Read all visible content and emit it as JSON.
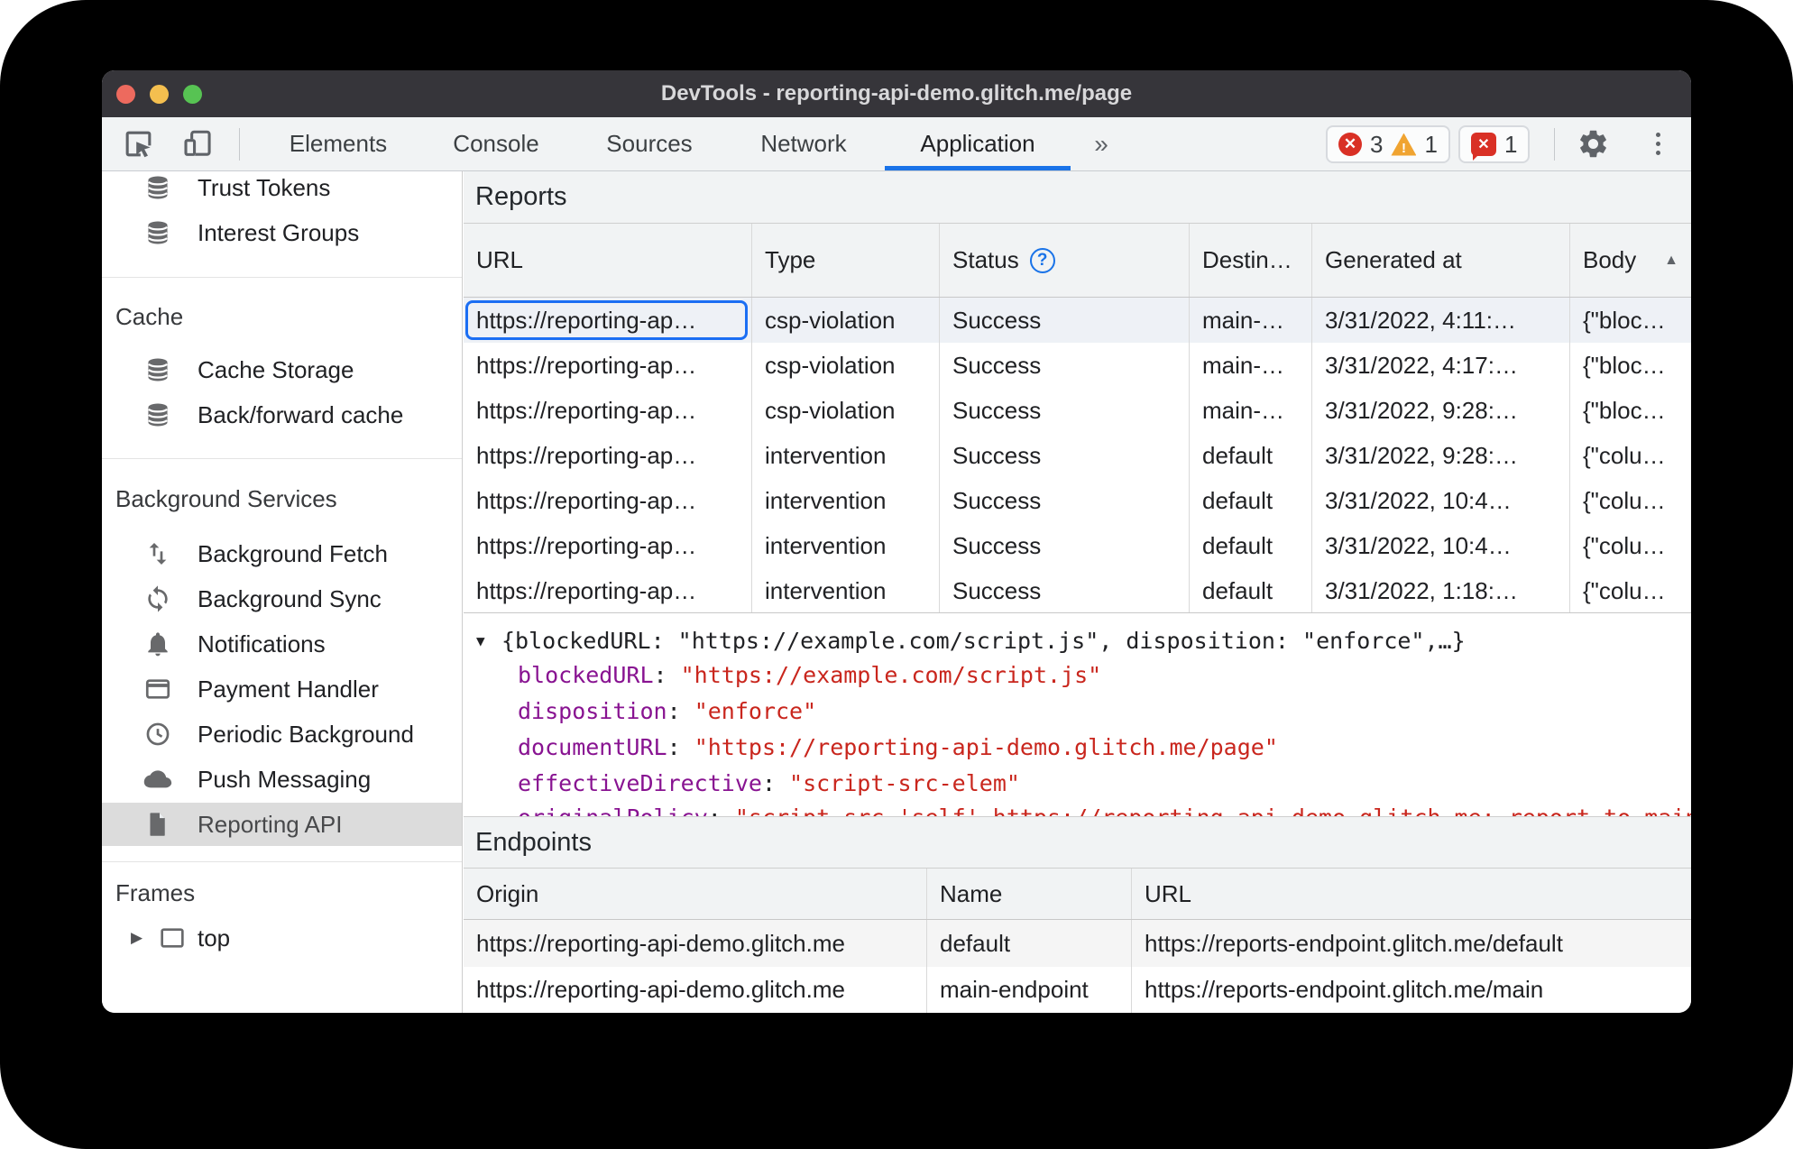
{
  "colors": {
    "accent": "#1a73e8",
    "error": "#d93025",
    "warning": "#f0a431",
    "json_key": "#881391",
    "json_string": "#c9261d",
    "traffic_red": "#ed6a5e",
    "traffic_yellow": "#f4bf4f",
    "traffic_green": "#57c353"
  },
  "window": {
    "title": "DevTools - reporting-api-demo.glitch.me/page",
    "traffic_buttons": [
      "close-button",
      "minimize-button",
      "zoom-button"
    ]
  },
  "toolbar": {
    "inspect_icon": "inspect-cursor-icon",
    "device_icon": "device-toolbar-icon",
    "tabs": [
      {
        "label": "Elements"
      },
      {
        "label": "Console"
      },
      {
        "label": "Sources"
      },
      {
        "label": "Network"
      },
      {
        "label": "Application",
        "selected": true
      }
    ],
    "more_tabs_symbol": "»",
    "badges": {
      "errors": "3",
      "warnings": "1",
      "issues": "1"
    },
    "gear_icon": "settings-gear-icon",
    "menu_icon": "kebab-menu-icon"
  },
  "sidebar": {
    "top_items": [
      {
        "label": "Trust Tokens",
        "icon": "database-icon"
      },
      {
        "label": "Interest Groups",
        "icon": "database-icon"
      }
    ],
    "sections": [
      {
        "title": "Cache",
        "items": [
          {
            "label": "Cache Storage",
            "icon": "database-icon"
          },
          {
            "label": "Back/forward cache",
            "icon": "database-icon"
          }
        ]
      },
      {
        "title": "Background Services",
        "items": [
          {
            "label": "Background Fetch",
            "icon": "background-fetch-icon"
          },
          {
            "label": "Background Sync",
            "icon": "background-sync-icon"
          },
          {
            "label": "Notifications",
            "icon": "bell-icon"
          },
          {
            "label": "Payment Handler",
            "icon": "payment-card-icon"
          },
          {
            "label": "Periodic Background",
            "icon": "clock-icon"
          },
          {
            "label": "Push Messaging",
            "icon": "cloud-icon"
          },
          {
            "label": "Reporting API",
            "icon": "document-icon",
            "selected": true
          }
        ]
      },
      {
        "title": "Frames",
        "items": [
          {
            "label": "top",
            "icon": "frame-icon",
            "expander": "▶"
          }
        ]
      }
    ]
  },
  "reports": {
    "heading": "Reports",
    "columns": [
      "URL",
      "Type",
      "Status",
      "Destin…",
      "Generated at",
      "Body"
    ],
    "status_help_icon": "help-icon",
    "sort_icon": "▲",
    "rows": [
      {
        "url": "https://reporting-ap…",
        "type": "csp-violation",
        "status": "Success",
        "destination": "main-…",
        "generated": "3/31/2022, 4:11:…",
        "body": "{\"bloc…",
        "selected": true
      },
      {
        "url": "https://reporting-ap…",
        "type": "csp-violation",
        "status": "Success",
        "destination": "main-…",
        "generated": "3/31/2022, 4:17:…",
        "body": "{\"bloc…"
      },
      {
        "url": "https://reporting-ap…",
        "type": "csp-violation",
        "status": "Success",
        "destination": "main-…",
        "generated": "3/31/2022, 9:28:…",
        "body": "{\"bloc…"
      },
      {
        "url": "https://reporting-ap…",
        "type": "intervention",
        "status": "Success",
        "destination": "default",
        "generated": "3/31/2022, 9:28:…",
        "body": "{\"colu…"
      },
      {
        "url": "https://reporting-ap…",
        "type": "intervention",
        "status": "Success",
        "destination": "default",
        "generated": "3/31/2022, 10:4…",
        "body": "{\"colu…"
      },
      {
        "url": "https://reporting-ap…",
        "type": "intervention",
        "status": "Success",
        "destination": "default",
        "generated": "3/31/2022, 10:4…",
        "body": "{\"colu…"
      },
      {
        "url": "https://reporting-ap…",
        "type": "intervention",
        "status": "Success",
        "destination": "default",
        "generated": "3/31/2022, 1:18:…",
        "body": "{\"colu…"
      }
    ]
  },
  "detail": {
    "expander": "▼",
    "summary": "{blockedURL: \"https://example.com/script.js\", disposition: \"enforce\",…}",
    "fields": [
      {
        "key": "blockedURL",
        "value": "\"https://example.com/script.js\""
      },
      {
        "key": "disposition",
        "value": "\"enforce\""
      },
      {
        "key": "documentURL",
        "value": "\"https://reporting-api-demo.glitch.me/page\""
      },
      {
        "key": "effectiveDirective",
        "value": "\"script-src-elem\""
      }
    ],
    "clipped_field": {
      "key": "originalPolicy",
      "value": "\"script-src 'self' https://reporting-api-demo.glitch.me; report-to main-endpoint; …\""
    }
  },
  "endpoints": {
    "heading": "Endpoints",
    "columns": [
      "Origin",
      "Name",
      "URL"
    ],
    "rows": [
      {
        "origin": "https://reporting-api-demo.glitch.me",
        "name": "default",
        "url": "https://reports-endpoint.glitch.me/default"
      },
      {
        "origin": "https://reporting-api-demo.glitch.me",
        "name": "main-endpoint",
        "url": "https://reports-endpoint.glitch.me/main"
      }
    ]
  }
}
